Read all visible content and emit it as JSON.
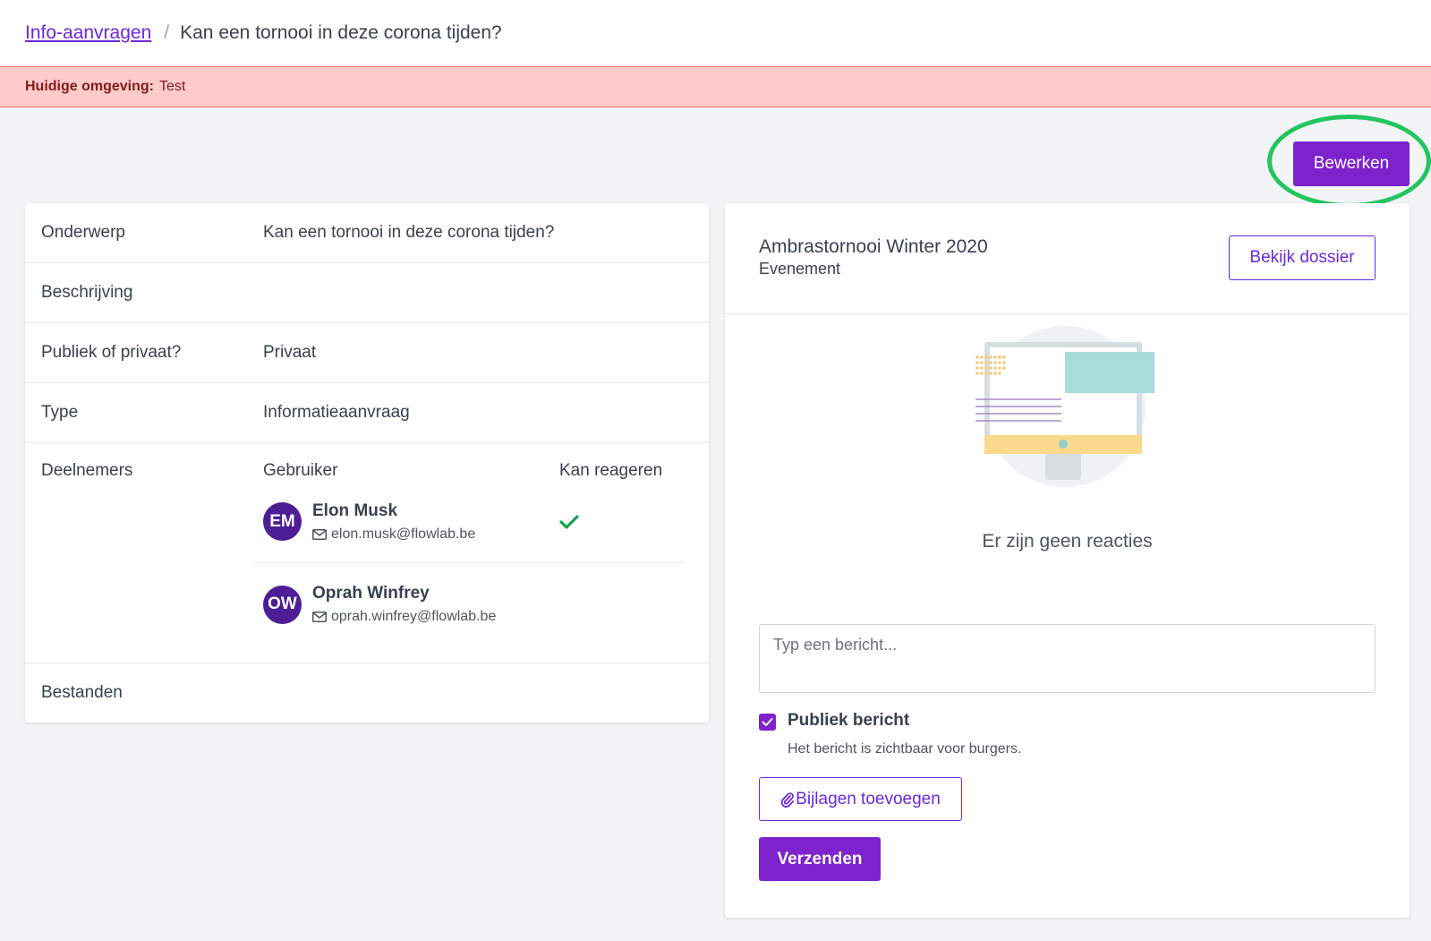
{
  "breadcrumb": {
    "parent_label": "Info-aanvragen",
    "separator": "/",
    "current_label": "Kan een tornooi in deze corona tijden?"
  },
  "environment": {
    "label": "Huidige omgeving:",
    "value": "Test"
  },
  "actions": {
    "edit_label": "Bewerken"
  },
  "details": {
    "subject_label": "Onderwerp",
    "subject_value": "Kan een tornooi in deze corona tijden?",
    "description_label": "Beschrijving",
    "description_value": "",
    "visibility_label": "Publiek of privaat?",
    "visibility_value": "Privaat",
    "type_label": "Type",
    "type_value": "Informatieaanvraag",
    "participants_label": "Deelnemers",
    "files_label": "Bestanden"
  },
  "participants": {
    "col_user": "Gebruiker",
    "col_can_react": "Kan reageren",
    "items": [
      {
        "initials": "EM",
        "name": "Elon Musk",
        "email": "elon.musk@flowlab.be",
        "can_react": true
      },
      {
        "initials": "OW",
        "name": "Oprah Winfrey",
        "email": "oprah.winfrey@flowlab.be",
        "can_react": false
      }
    ]
  },
  "dossier": {
    "title": "Ambrastornooi Winter 2020",
    "subtitle": "Evenement",
    "view_label": "Bekijk dossier"
  },
  "reactions": {
    "empty_text": "Er zijn geen reacties"
  },
  "composer": {
    "placeholder": "Typ een bericht...",
    "public_label": "Publiek bericht",
    "public_checked": true,
    "public_help": "Het bericht is zichtbaar voor burgers.",
    "attach_label": "Bijlagen toevoegen",
    "send_label": "Verzenden"
  },
  "colors": {
    "accent": "#7e22ce",
    "env_banner": "#fecaca",
    "highlight_ring": "#22c55e",
    "check": "#16a34a"
  },
  "icons": [
    "mail-icon",
    "check-icon",
    "paperclip-icon",
    "checkbox-checked-icon"
  ]
}
